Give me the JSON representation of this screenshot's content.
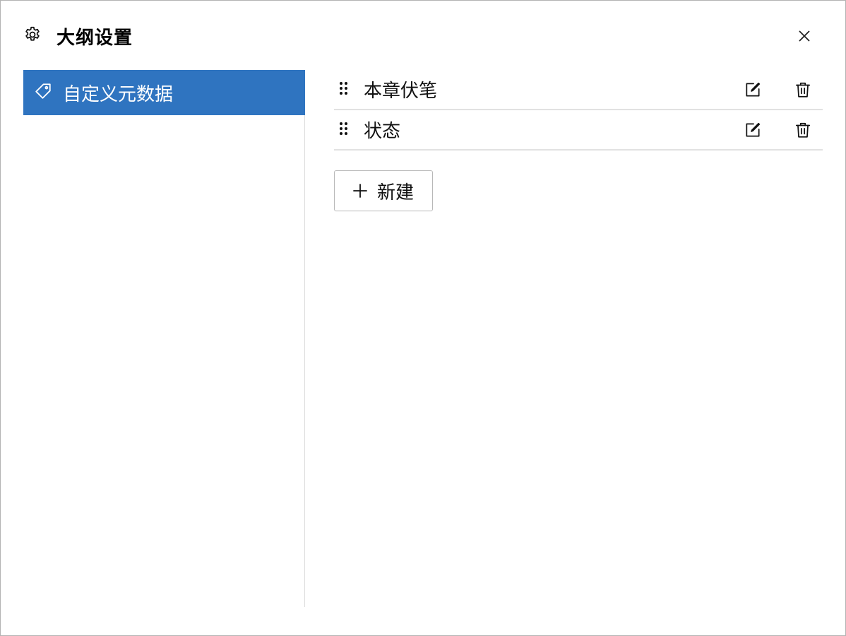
{
  "dialog": {
    "title": "大纲设置",
    "icon": "gear-icon",
    "close_icon": "close-icon"
  },
  "sidebar": {
    "items": [
      {
        "label": "自定义元数据",
        "icon": "tag-icon",
        "active": true
      }
    ]
  },
  "main": {
    "rows": [
      {
        "label": "本章伏笔"
      },
      {
        "label": "状态"
      }
    ],
    "new_button_label": "新建"
  },
  "colors": {
    "accent": "#2f74c0",
    "divider": "#e2e2e2",
    "border": "#b3b3b3"
  }
}
